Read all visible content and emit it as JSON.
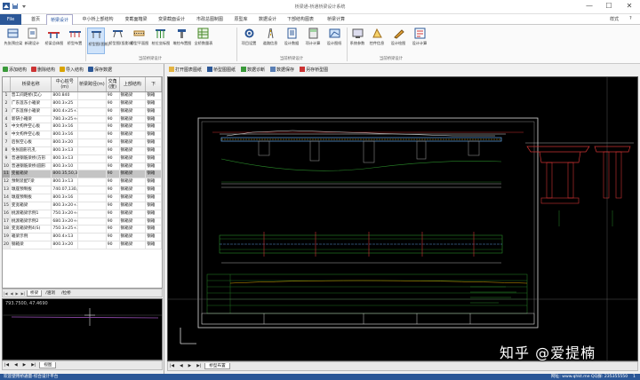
{
  "app": {
    "title": "桥梁通-桥通桥梁设计系统"
  },
  "window": {
    "minimize": "—",
    "maximize": "☐",
    "close": "✕"
  },
  "menubar": {
    "file": "File",
    "tabs": [
      "首页",
      "桥梁设计",
      "中小桥上部结构",
      "变截面箱梁",
      "变梁截面设计",
      "市政总图制图",
      "原型库",
      "数据设计",
      "下部结构图表",
      "桥梁计算"
    ],
    "active": 1,
    "style_label": "样式",
    "help_label": "?"
  },
  "ribbon": {
    "groups": [
      {
        "label": "",
        "buttons": [
          "先张预应梁",
          "新建设计",
          "桥梁总体图"
        ]
      },
      {
        "label": "",
        "buttons": [
          "桥型布置"
        ]
      },
      {
        "label": "当前桥梁设计",
        "buttons": [
          "桥型图(图纸)",
          "桥型图(投影线)",
          "桥型平面图",
          "桩位坐标图",
          "墩柱布置图",
          "全桥数量表"
        ]
      },
      {
        "label": "当前桥梁设计",
        "buttons": [
          "项目设置",
          "道路信息",
          "设计数据",
          "项计计算",
          "设计图纸"
        ]
      },
      {
        "label": "当前桥梁设计",
        "buttons": [
          "系统参数",
          "控件信息",
          "设计绘图",
          "设计计算"
        ]
      }
    ],
    "active_button": "桥型图(图纸)"
  },
  "left_toolbar": [
    "添加结构",
    "删除结构",
    "导入结构",
    "保存数据"
  ],
  "grid": {
    "columns": [
      "",
      "桥梁名称",
      "中心桩号(m)",
      "桥梁跨径(m)",
      "交角(度)",
      "上部结构",
      "下"
    ],
    "rows": [
      [
        "1",
        "普工间距桥(实心",
        "800.840",
        "",
        "90",
        "钢箱梁",
        "钢箱"
      ],
      [
        "2",
        "广东莲东小箱梁",
        "800.3×25",
        "",
        "90",
        "钢箱梁",
        "钢箱"
      ],
      [
        "3",
        "广东莲保小箱梁",
        "800.4×25+3×25",
        "",
        "90",
        "钢箱梁",
        "钢箱"
      ],
      [
        "4",
        "新研小箱梁",
        "780.3×25+4×25+3",
        "",
        "90",
        "钢箱梁",
        "钢箱"
      ],
      [
        "5",
        "中文构件空心板",
        "800.3×16",
        "",
        "90",
        "钢箱梁",
        "钢箱"
      ],
      [
        "6",
        "中文构件空心板",
        "800.3×16",
        "",
        "90",
        "钢箱梁",
        "钢箱"
      ],
      [
        "7",
        "后张空心板",
        "800.3×20",
        "",
        "90",
        "钢箱梁",
        "钢箱"
      ],
      [
        "8",
        "免张圆形孔孔",
        "800.3×13",
        "",
        "90",
        "钢箱梁",
        "钢箱"
      ],
      [
        "9",
        "普通钢筋梁桥(方形",
        "800.3×13",
        "",
        "90",
        "钢箱梁",
        "钢箱"
      ],
      [
        "10",
        "普通钢筋梁桥(圆形",
        "800.3×10",
        "",
        "90",
        "钢箱梁",
        "钢箱"
      ],
      [
        "11",
        "变截箱梁",
        "800.35,50,35",
        "",
        "90",
        "钢箱梁",
        "钢箱"
      ],
      [
        "12",
        "预制装配T梁",
        "800.3×13",
        "",
        "90",
        "钢箱梁",
        "钢箱"
      ],
      [
        "13",
        "墩座预制板",
        "740.07,130,07",
        "",
        "90",
        "钢箱梁",
        "钢箱"
      ],
      [
        "14",
        "墩座预制板",
        "800.3×16",
        "",
        "90",
        "钢箱梁",
        "钢箱"
      ],
      [
        "15",
        "变宽箱梁",
        "800.3×20+3×25+3",
        "",
        "90",
        "钢箱梁",
        "钢箱"
      ],
      [
        "16",
        "桃渡箱梁示例1",
        "750.3×20+4×25+4",
        "",
        "90",
        "钢箱梁",
        "钢箱"
      ],
      [
        "17",
        "桃渡箱梁示例2",
        "680.3×20+4×25+4",
        "",
        "90",
        "钢箱梁",
        "钢箱"
      ],
      [
        "18",
        "变宽箱梁例4(S)",
        "750.3×25+37,60,",
        "",
        "90",
        "钢箱梁",
        "钢箱"
      ],
      [
        "19",
        "箱梁示例",
        "800.4×13",
        "",
        "90",
        "钢箱梁",
        "钢箱"
      ],
      [
        "20",
        "钢箱梁",
        "800.3×20",
        "",
        "90",
        "钢箱梁",
        "钢箱"
      ]
    ],
    "selected_index": 10
  },
  "sheet_tabs": {
    "nav": [
      "|◀",
      "◀",
      "▶",
      "▶|"
    ],
    "tabs": [
      "桥梁",
      "/涵洞",
      "/拉桥"
    ],
    "active": 0
  },
  "mini_cad": {
    "coord": "793.7500, 47.4690",
    "tabs": [
      "|◀",
      "◀",
      "▶",
      "▶|",
      "视图"
    ]
  },
  "right_toolbar": [
    "打开图表图纸",
    "桥型图图纸",
    "数据诊断",
    "数据保存",
    "另存桥型图"
  ],
  "bottom_tabs": [
    "|◀",
    "◀",
    "▶",
    "▶|",
    "桥型布置"
  ],
  "watermark": "知乎 @爱提楠",
  "statusbar": {
    "left": "欢迎使用桥通量-综合设计平台",
    "mid": "网址: www.qhkt.me QQ群: 235355550",
    "right": "1"
  },
  "colors": {
    "accent": "#2b5797",
    "cad_bg": "#000000"
  }
}
